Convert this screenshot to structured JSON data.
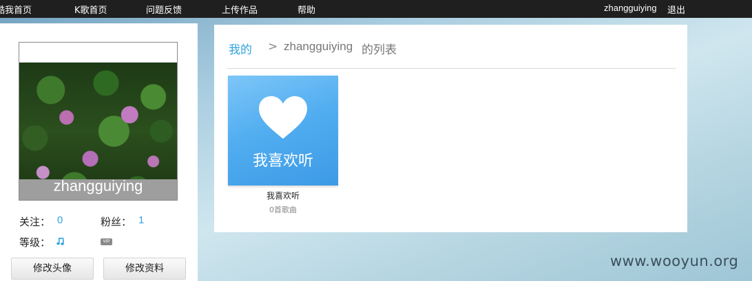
{
  "nav": {
    "items": [
      "酷我首页",
      "K歌首页",
      "问题反馈",
      "上传作品",
      "帮助"
    ],
    "username": "zhangguiying",
    "logout": "退出"
  },
  "profile": {
    "avatar_caption": "zhangguiying",
    "follow_label": "关注：",
    "follow_count": "0",
    "fans_label": "粉丝：",
    "fans_count": "1",
    "level_label": "等级：",
    "level_icon": "music-note-icon",
    "vip_badge": "VIP",
    "edit_avatar": "修改头像",
    "edit_profile": "修改资料"
  },
  "main": {
    "breadcrumb_home": "我的",
    "breadcrumb_sep": ">",
    "breadcrumb_user": "zhangguiying",
    "breadcrumb_suffix": "的列表",
    "playlists": [
      {
        "cover_caption": "我喜欢听",
        "cover_icon": "heart-icon",
        "title": "我喜欢听",
        "count": "0首歌曲"
      }
    ]
  },
  "watermark": "www.wooyun.org",
  "colors": {
    "accent": "#2fa3dd",
    "card_blue": "#52aef0",
    "topbar": "#1f1f1f"
  }
}
